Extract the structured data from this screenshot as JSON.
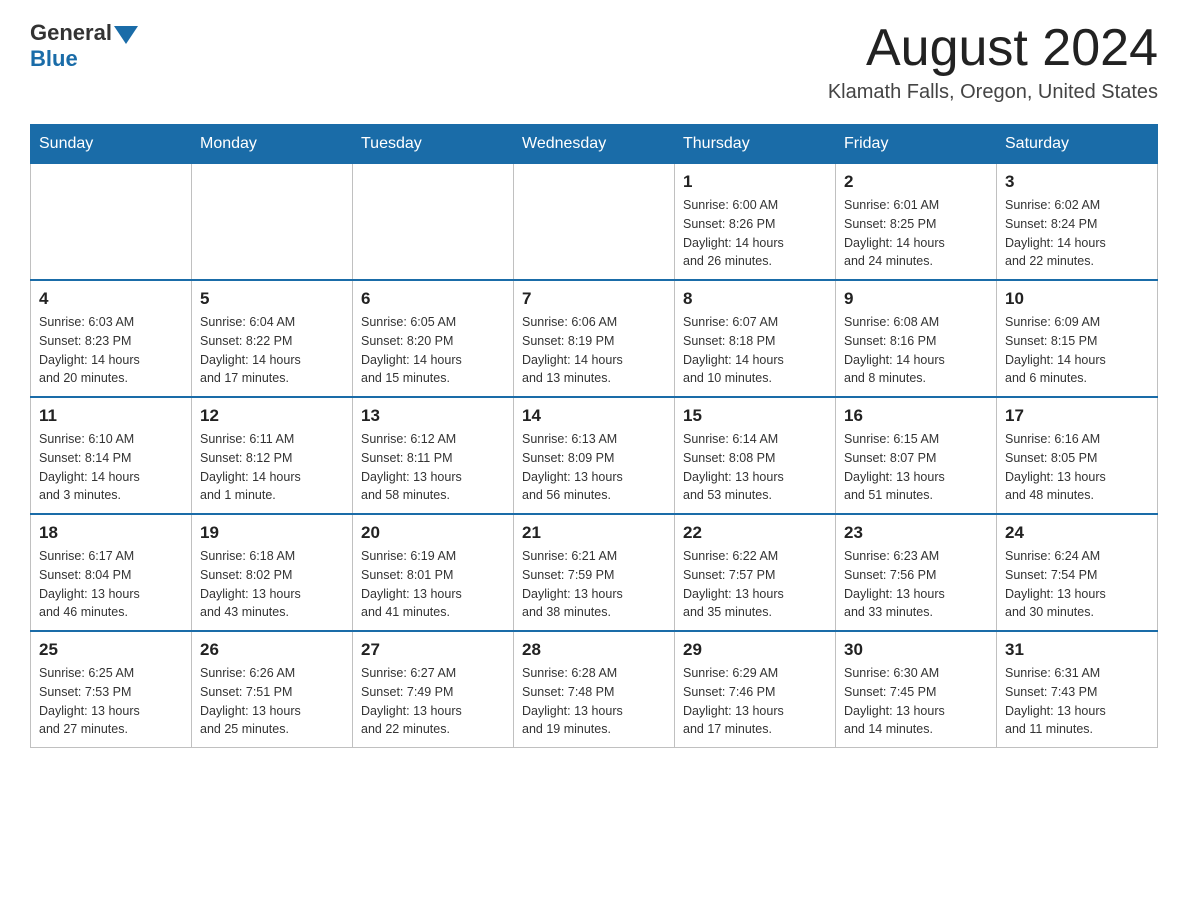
{
  "header": {
    "logo_general": "General",
    "logo_blue": "Blue",
    "month_title": "August 2024",
    "location": "Klamath Falls, Oregon, United States"
  },
  "weekdays": [
    "Sunday",
    "Monday",
    "Tuesday",
    "Wednesday",
    "Thursday",
    "Friday",
    "Saturday"
  ],
  "weeks": [
    [
      {
        "day": "",
        "info": ""
      },
      {
        "day": "",
        "info": ""
      },
      {
        "day": "",
        "info": ""
      },
      {
        "day": "",
        "info": ""
      },
      {
        "day": "1",
        "info": "Sunrise: 6:00 AM\nSunset: 8:26 PM\nDaylight: 14 hours\nand 26 minutes."
      },
      {
        "day": "2",
        "info": "Sunrise: 6:01 AM\nSunset: 8:25 PM\nDaylight: 14 hours\nand 24 minutes."
      },
      {
        "day": "3",
        "info": "Sunrise: 6:02 AM\nSunset: 8:24 PM\nDaylight: 14 hours\nand 22 minutes."
      }
    ],
    [
      {
        "day": "4",
        "info": "Sunrise: 6:03 AM\nSunset: 8:23 PM\nDaylight: 14 hours\nand 20 minutes."
      },
      {
        "day": "5",
        "info": "Sunrise: 6:04 AM\nSunset: 8:22 PM\nDaylight: 14 hours\nand 17 minutes."
      },
      {
        "day": "6",
        "info": "Sunrise: 6:05 AM\nSunset: 8:20 PM\nDaylight: 14 hours\nand 15 minutes."
      },
      {
        "day": "7",
        "info": "Sunrise: 6:06 AM\nSunset: 8:19 PM\nDaylight: 14 hours\nand 13 minutes."
      },
      {
        "day": "8",
        "info": "Sunrise: 6:07 AM\nSunset: 8:18 PM\nDaylight: 14 hours\nand 10 minutes."
      },
      {
        "day": "9",
        "info": "Sunrise: 6:08 AM\nSunset: 8:16 PM\nDaylight: 14 hours\nand 8 minutes."
      },
      {
        "day": "10",
        "info": "Sunrise: 6:09 AM\nSunset: 8:15 PM\nDaylight: 14 hours\nand 6 minutes."
      }
    ],
    [
      {
        "day": "11",
        "info": "Sunrise: 6:10 AM\nSunset: 8:14 PM\nDaylight: 14 hours\nand 3 minutes."
      },
      {
        "day": "12",
        "info": "Sunrise: 6:11 AM\nSunset: 8:12 PM\nDaylight: 14 hours\nand 1 minute."
      },
      {
        "day": "13",
        "info": "Sunrise: 6:12 AM\nSunset: 8:11 PM\nDaylight: 13 hours\nand 58 minutes."
      },
      {
        "day": "14",
        "info": "Sunrise: 6:13 AM\nSunset: 8:09 PM\nDaylight: 13 hours\nand 56 minutes."
      },
      {
        "day": "15",
        "info": "Sunrise: 6:14 AM\nSunset: 8:08 PM\nDaylight: 13 hours\nand 53 minutes."
      },
      {
        "day": "16",
        "info": "Sunrise: 6:15 AM\nSunset: 8:07 PM\nDaylight: 13 hours\nand 51 minutes."
      },
      {
        "day": "17",
        "info": "Sunrise: 6:16 AM\nSunset: 8:05 PM\nDaylight: 13 hours\nand 48 minutes."
      }
    ],
    [
      {
        "day": "18",
        "info": "Sunrise: 6:17 AM\nSunset: 8:04 PM\nDaylight: 13 hours\nand 46 minutes."
      },
      {
        "day": "19",
        "info": "Sunrise: 6:18 AM\nSunset: 8:02 PM\nDaylight: 13 hours\nand 43 minutes."
      },
      {
        "day": "20",
        "info": "Sunrise: 6:19 AM\nSunset: 8:01 PM\nDaylight: 13 hours\nand 41 minutes."
      },
      {
        "day": "21",
        "info": "Sunrise: 6:21 AM\nSunset: 7:59 PM\nDaylight: 13 hours\nand 38 minutes."
      },
      {
        "day": "22",
        "info": "Sunrise: 6:22 AM\nSunset: 7:57 PM\nDaylight: 13 hours\nand 35 minutes."
      },
      {
        "day": "23",
        "info": "Sunrise: 6:23 AM\nSunset: 7:56 PM\nDaylight: 13 hours\nand 33 minutes."
      },
      {
        "day": "24",
        "info": "Sunrise: 6:24 AM\nSunset: 7:54 PM\nDaylight: 13 hours\nand 30 minutes."
      }
    ],
    [
      {
        "day": "25",
        "info": "Sunrise: 6:25 AM\nSunset: 7:53 PM\nDaylight: 13 hours\nand 27 minutes."
      },
      {
        "day": "26",
        "info": "Sunrise: 6:26 AM\nSunset: 7:51 PM\nDaylight: 13 hours\nand 25 minutes."
      },
      {
        "day": "27",
        "info": "Sunrise: 6:27 AM\nSunset: 7:49 PM\nDaylight: 13 hours\nand 22 minutes."
      },
      {
        "day": "28",
        "info": "Sunrise: 6:28 AM\nSunset: 7:48 PM\nDaylight: 13 hours\nand 19 minutes."
      },
      {
        "day": "29",
        "info": "Sunrise: 6:29 AM\nSunset: 7:46 PM\nDaylight: 13 hours\nand 17 minutes."
      },
      {
        "day": "30",
        "info": "Sunrise: 6:30 AM\nSunset: 7:45 PM\nDaylight: 13 hours\nand 14 minutes."
      },
      {
        "day": "31",
        "info": "Sunrise: 6:31 AM\nSunset: 7:43 PM\nDaylight: 13 hours\nand 11 minutes."
      }
    ]
  ]
}
